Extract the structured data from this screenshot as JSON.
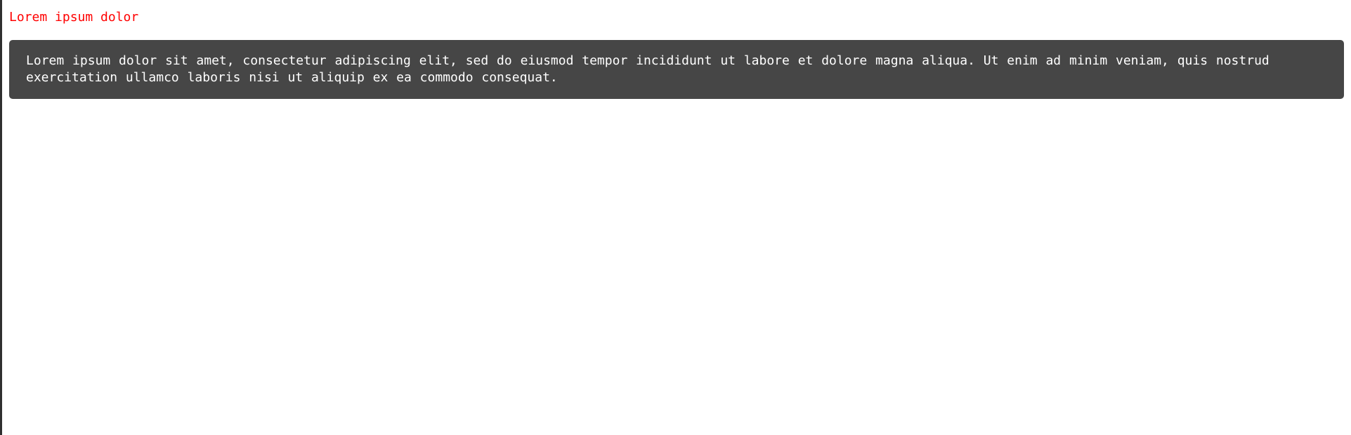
{
  "heading": {
    "text": "Lorem ipsum dolor",
    "color": "#ff0000"
  },
  "panel": {
    "text": "Lorem ipsum dolor sit amet, consectetur adipiscing elit, sed do eiusmod tempor incididunt ut labore et dolore magna aliqua. Ut enim ad minim veniam, quis nostrud exercitation ullamco laboris nisi ut aliquip ex ea commodo consequat.",
    "background": "#464646",
    "text_color": "#ffffff"
  },
  "page": {
    "background": "#ffffff",
    "left_border_color": "#2f2f2f"
  }
}
